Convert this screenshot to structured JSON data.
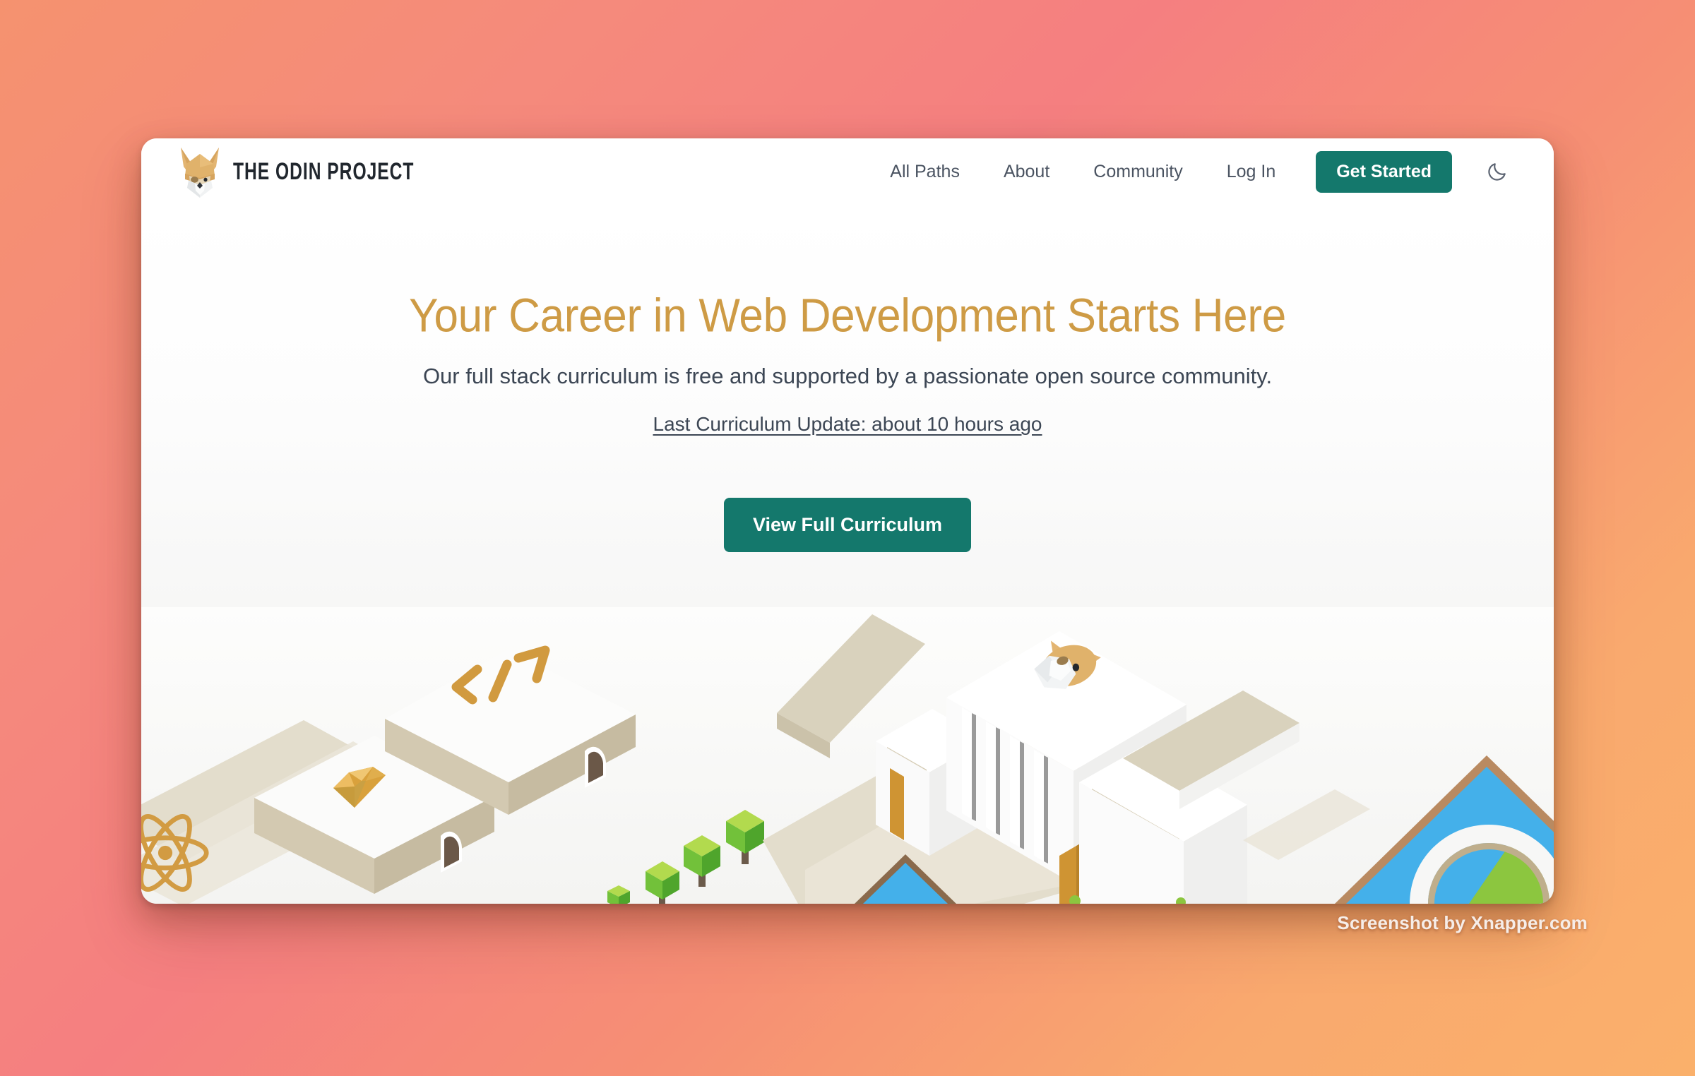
{
  "background": {
    "gradient_from": "#f5926f",
    "gradient_mid": "#f57f80",
    "gradient_to": "#fab06b"
  },
  "brand": {
    "name": "THE ODIN PROJECT",
    "logo_icon": "odin-viking-head-icon",
    "helmet_color": "#e0b26b",
    "beard_color": "#eceeef"
  },
  "nav": {
    "links": [
      {
        "label": "All Paths",
        "name": "nav-all-paths"
      },
      {
        "label": "About",
        "name": "nav-about"
      },
      {
        "label": "Community",
        "name": "nav-community"
      },
      {
        "label": "Log In",
        "name": "nav-log-in"
      }
    ],
    "cta_label": "Get Started",
    "cta_color": "#14786c",
    "theme_toggle_icon": "moon-icon"
  },
  "hero": {
    "title": "Your Career in Web Development Starts Here",
    "title_color": "#ce9b45",
    "subtitle": "Our full stack curriculum is free and supported by a passionate open source community.",
    "update_link": "Last Curriculum Update: about 10 hours ago",
    "cta_label": "View Full Curriculum",
    "cta_color": "#14786c"
  },
  "illustration": {
    "style": "isometric-city",
    "description": "Isometric beige platforms and white buildings with an Odin mascot head, cube trees, a Ruby gem, code brackets, a React atom and a blue-green pyramid roof.",
    "colors": {
      "platform_top": "#fbfbfa",
      "platform_side": "#d4cbb4",
      "path": "#e2dccb",
      "accent_gold": "#cf9433",
      "tree_light": "#a8d44a",
      "tree_mid": "#72c13a",
      "tree_dark": "#4fa52c",
      "trunk": "#6b5a4a",
      "roof_blue": "#44b0ea",
      "roof_green": "#8cc63f",
      "roof_edge": "#b98a61",
      "door_gold": "#cf9433",
      "doorway_dark": "#6b5848"
    }
  },
  "watermark": "Screenshot by Xnapper.com"
}
